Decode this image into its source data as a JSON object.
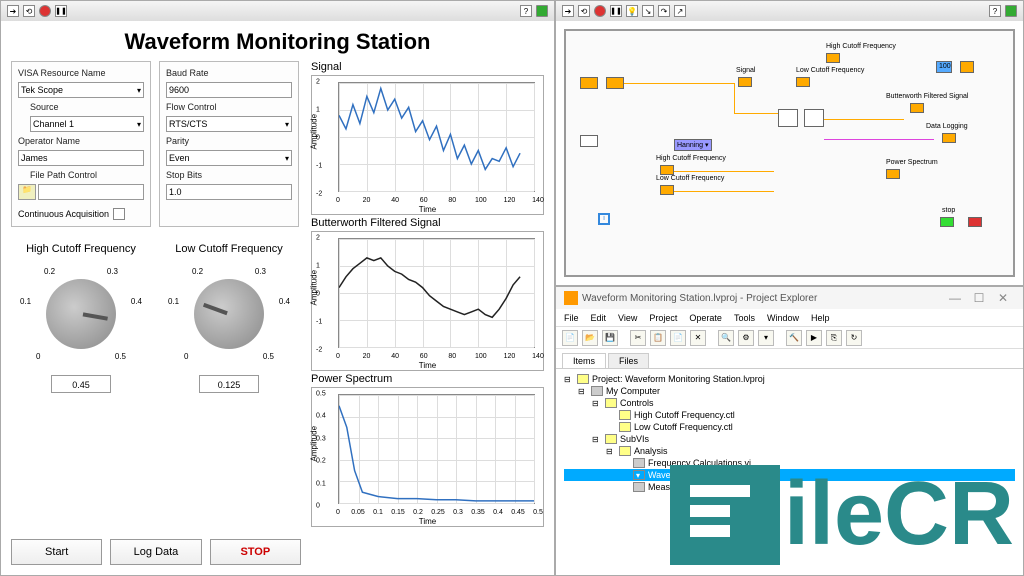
{
  "title": "Waveform Monitoring Station",
  "config_left": {
    "visa_lbl": "VISA Resource Name",
    "visa_val": "Tek Scope",
    "source_lbl": "Source",
    "source_val": "Channel 1",
    "operator_lbl": "Operator Name",
    "operator_val": "James",
    "file_lbl": "File Path Control",
    "cont_acq_lbl": "Continuous Acquisition"
  },
  "config_right": {
    "baud_lbl": "Baud Rate",
    "baud_val": "9600",
    "flow_lbl": "Flow Control",
    "flow_val": "RTS/CTS",
    "parity_lbl": "Parity",
    "parity_val": "Even",
    "stop_lbl": "Stop Bits",
    "stop_val": "1.0"
  },
  "knobs": {
    "high_lbl": "High Cutoff Frequency",
    "high_val": "0.45",
    "low_lbl": "Low Cutoff Frequency",
    "low_val": "0.125",
    "ticks": [
      "0",
      "0.1",
      "0.2",
      "0.3",
      "0.4",
      "0.5"
    ]
  },
  "buttons": {
    "start": "Start",
    "log": "Log Data",
    "stop": "STOP"
  },
  "chart_data": [
    {
      "type": "line",
      "title": "Signal",
      "xlabel": "Time",
      "ylabel": "Amplitude",
      "xlim": [
        0,
        140
      ],
      "ylim": [
        -2,
        2
      ],
      "xticks": [
        0,
        20,
        40,
        60,
        80,
        100,
        120,
        140
      ],
      "yticks": [
        -2,
        -1,
        0,
        1,
        2
      ],
      "color": "#3070c0",
      "x": [
        0,
        5,
        10,
        15,
        20,
        25,
        30,
        35,
        40,
        45,
        50,
        55,
        60,
        65,
        70,
        75,
        80,
        85,
        90,
        95,
        100,
        105,
        110,
        115,
        120,
        125,
        130
      ],
      "y": [
        0.8,
        0.3,
        1.2,
        0.5,
        1.5,
        0.9,
        1.8,
        1.0,
        1.4,
        0.7,
        1.1,
        0.2,
        0.6,
        -0.1,
        0.4,
        -0.5,
        0.1,
        -0.8,
        -0.3,
        -1.0,
        -0.5,
        -1.2,
        -0.8,
        -0.9,
        -0.4,
        -1.1,
        -0.6
      ]
    },
    {
      "type": "line",
      "title": "Butterworth Filtered Signal",
      "xlabel": "Time",
      "ylabel": "Amplitude",
      "xlim": [
        0,
        140
      ],
      "ylim": [
        -2,
        2
      ],
      "xticks": [
        0,
        20,
        40,
        60,
        80,
        100,
        120,
        140
      ],
      "yticks": [
        -2,
        -1,
        0,
        1,
        2
      ],
      "color": "#222",
      "x": [
        0,
        5,
        10,
        15,
        20,
        25,
        30,
        35,
        40,
        45,
        50,
        55,
        60,
        65,
        70,
        75,
        80,
        85,
        90,
        95,
        100,
        105,
        110,
        115,
        120,
        125,
        130
      ],
      "y": [
        0.2,
        0.6,
        0.9,
        1.1,
        1.3,
        1.2,
        1.3,
        1.0,
        0.8,
        0.7,
        0.5,
        0.4,
        0.2,
        -0.1,
        -0.3,
        -0.5,
        -0.6,
        -0.7,
        -0.8,
        -0.7,
        -0.6,
        -0.8,
        -0.9,
        -0.6,
        -0.2,
        0.3,
        0.6
      ]
    },
    {
      "type": "line",
      "title": "Power Spectrum",
      "xlabel": "Time",
      "ylabel": "Amplitude",
      "xlim": [
        0,
        0.5
      ],
      "ylim": [
        0,
        0.5
      ],
      "xticks": [
        0,
        0.05,
        0.1,
        0.15,
        0.2,
        0.25,
        0.3,
        0.35,
        0.4,
        0.45,
        0.5
      ],
      "yticks": [
        0,
        0.1,
        0.2,
        0.3,
        0.4,
        0.5
      ],
      "color": "#3070c0",
      "x": [
        0,
        0.02,
        0.04,
        0.06,
        0.08,
        0.1,
        0.15,
        0.2,
        0.25,
        0.3,
        0.35,
        0.4,
        0.45,
        0.5
      ],
      "y": [
        0.45,
        0.35,
        0.15,
        0.05,
        0.04,
        0.03,
        0.02,
        0.02,
        0.015,
        0.015,
        0.01,
        0.01,
        0.01,
        0.01
      ]
    }
  ],
  "diagram": {
    "labels": {
      "high_cutoff": "High Cutoff Frequency",
      "low_cutoff": "Low Cutoff Frequency",
      "signal": "Signal",
      "butterworth": "Butterworth Filtered Signal",
      "data_logging": "Data Logging",
      "power_spectrum": "Power Spectrum",
      "hanning": "Hanning",
      "stop": "stop",
      "hundred": "100"
    }
  },
  "project_explorer": {
    "window_title": "Waveform Monitoring Station.lvproj - Project Explorer",
    "menu": [
      "File",
      "Edit",
      "View",
      "Project",
      "Operate",
      "Tools",
      "Window",
      "Help"
    ],
    "tabs": [
      "Items",
      "Files"
    ],
    "tree": {
      "project": "Project: Waveform Monitoring Station.lvproj",
      "computer": "My Computer",
      "controls": "Controls",
      "hc_ctl": "High Cutoff Frequency.ctl",
      "lc_ctl": "Low Cutoff Frequency.ctl",
      "subvis": "SubVIs",
      "analysis": "Analysis",
      "freq_calc": "Frequency Calculations.vi",
      "sel_item": "Waveform Analysis.vi",
      "item2": "Measurement.vi"
    }
  },
  "logo": "ileCR"
}
